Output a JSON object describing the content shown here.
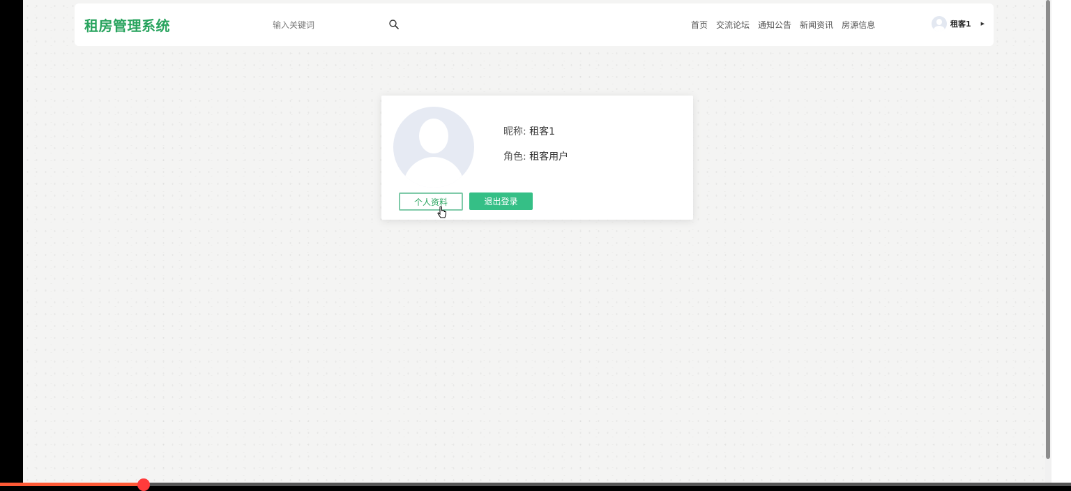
{
  "header": {
    "logo": "租房管理系统",
    "search": {
      "placeholder": "输入关键词",
      "value": ""
    },
    "nav": [
      "首页",
      "交流论坛",
      "通知公告",
      "新闻资讯",
      "房源信息"
    ],
    "user": {
      "name": "租客1"
    }
  },
  "profile_card": {
    "nickname_label": "昵称:",
    "nickname_value": "租客1",
    "role_label": "角色:",
    "role_value": "租客用户",
    "profile_button": "个人资料",
    "logout_button": "退出登录"
  },
  "colors": {
    "brand_green": "#27a35d",
    "button_green": "#35bf86",
    "page_background": "#f4f4f3"
  }
}
